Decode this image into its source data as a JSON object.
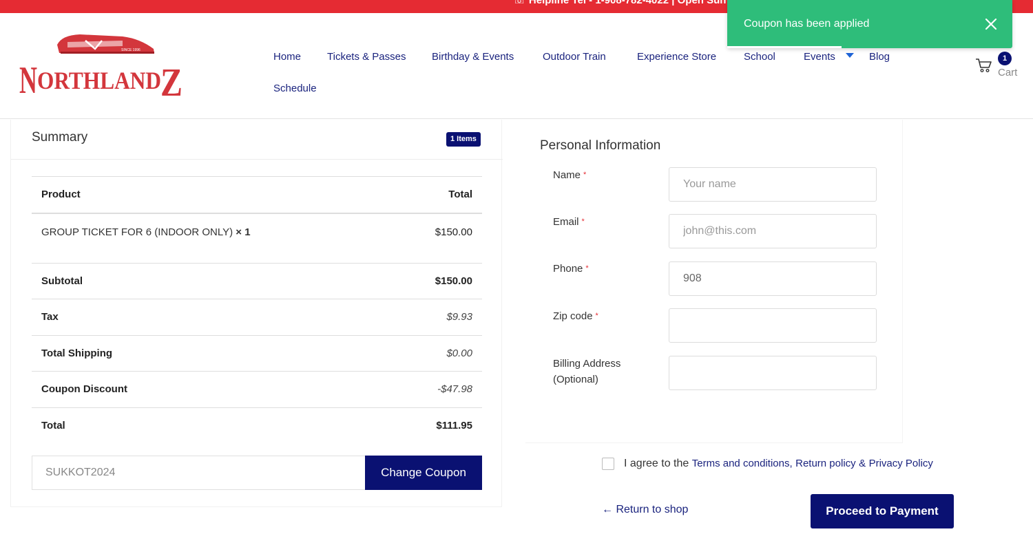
{
  "topbar": {
    "text": "☏ Helpline Tel - 1-908-782-4022 | Open Sun"
  },
  "logo": {
    "text": "NorthlandZ",
    "since": "SINCE 1996"
  },
  "nav": {
    "items": [
      "Home",
      "Tickets & Passes",
      "Birthday & Events",
      "Outdoor Train",
      "Experience Store",
      "School",
      "Events",
      "Blog",
      "Schedule"
    ]
  },
  "cart": {
    "count": "1",
    "label": "Cart"
  },
  "toast": {
    "message": "Coupon has been applied"
  },
  "summary": {
    "title": "Summary",
    "items_badge": "1 Items",
    "header": {
      "product": "Product",
      "total": "Total"
    },
    "line_item": {
      "name": "GROUP TICKET FOR 6 (INDOOR ONLY)",
      "qty": "× 1",
      "price": "$150.00"
    },
    "rows": [
      {
        "label": "Subtotal",
        "value": "$150.00"
      },
      {
        "label": "Tax",
        "value": "$9.93"
      },
      {
        "label": "Total Shipping",
        "value": "$0.00"
      },
      {
        "label": "Coupon Discount",
        "value": "-$47.98"
      },
      {
        "label": "Total",
        "value": "$111.95"
      }
    ],
    "coupon_value": "SUKKOT2024",
    "coupon_button": "Change Coupon"
  },
  "personal": {
    "title": "Personal Information",
    "fields": [
      {
        "label": "Name",
        "placeholder": "Your name",
        "value": ""
      },
      {
        "label": "Email",
        "placeholder": "john@this.com",
        "value": ""
      },
      {
        "label": "Phone",
        "placeholder": "",
        "value": "908"
      },
      {
        "label": "Zip code",
        "placeholder": "",
        "value": ""
      },
      {
        "label": "Billing Address (Optional)",
        "placeholder": "",
        "value": ""
      }
    ],
    "required_mark": "*"
  },
  "agree": {
    "prefix": "I agree to the",
    "terms": "Terms and conditions,",
    "return_policy": "Return policy",
    "amp": "&",
    "privacy": "Privacy Policy"
  },
  "actions": {
    "return": "← Return to shop",
    "proceed": "Proceed to Payment"
  },
  "colors": {
    "brand_red": "#e52b33",
    "navy": "#0a1172",
    "toast_green": "#2ebd7a"
  }
}
